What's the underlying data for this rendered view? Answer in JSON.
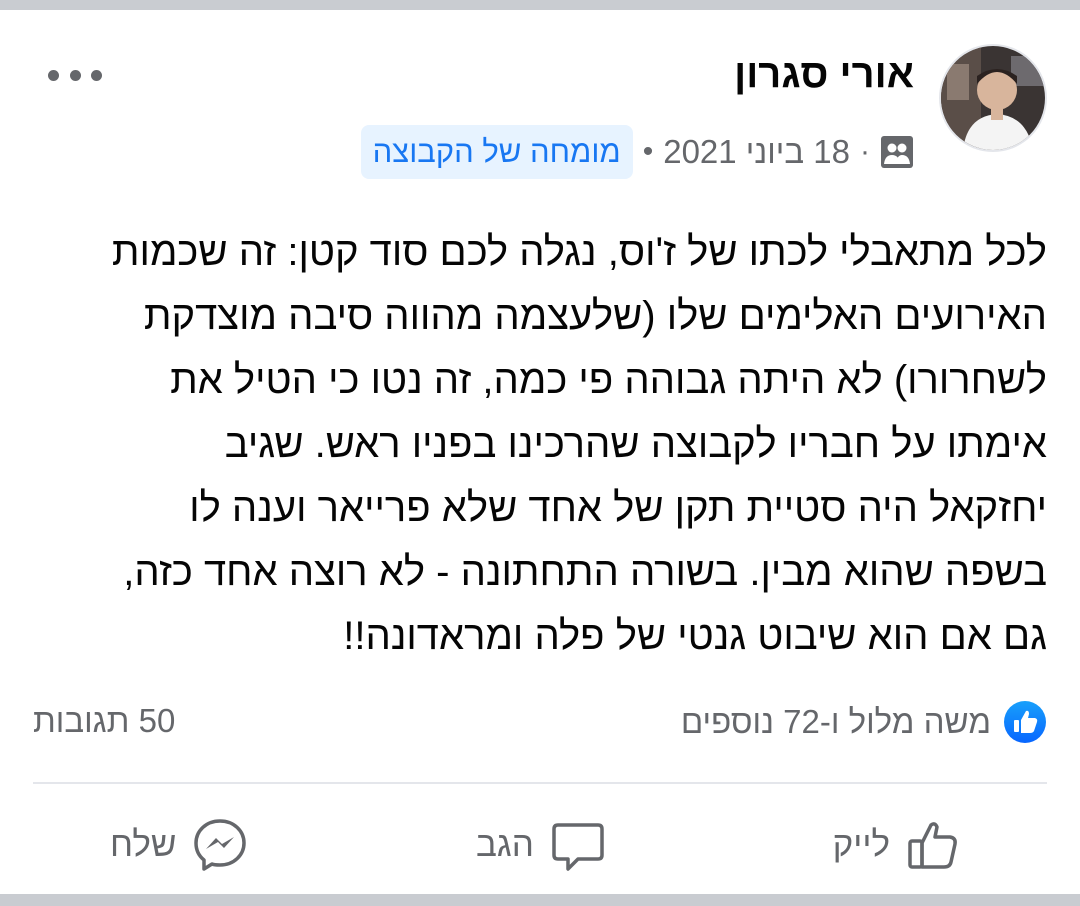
{
  "post": {
    "author_name": "אורי סגרון",
    "author_badge": "מומחה של הקבוצה",
    "meta_sep_1": "•",
    "date": "18 ביוני 2021",
    "meta_sep_2": "·",
    "audience_icon": "group-icon",
    "more_icon": "more-options-icon",
    "body_lines": [
      "לכל מתאבלי לכתו של ז'וס, נגלה לכם סוד קטן: זה שכמות",
      "האירועים האלימים שלו (שלעצמה מהווה סיבה מוצדקת",
      "לשחרורו) לא היתה גבוהה פי כמה, זה נטו כי הטיל את",
      "אימתו על חבריו לקבוצה שהרכינו בפניו ראש. שגיב",
      "יחזקאל היה סטיית תקן של אחד שלא פרייאר וענה לו",
      "בשפה שהוא מבין. בשורה התחתונה - לא רוצה אחד כזה,",
      "גם אם הוא שיבוט גנטי של פלה ומראדונה!!"
    ]
  },
  "engagement": {
    "reactions_text": "משה מלול ו-72 נוספים",
    "comments_count": "50 תגובות",
    "like_badge_icon": "like-reaction-icon"
  },
  "actions": {
    "like_label": "לייק",
    "comment_label": "הגב",
    "send_label": "שלח"
  },
  "colors": {
    "accent": "#1877f2",
    "badge_bg": "#e7f3ff",
    "secondary_text": "#65676b",
    "divider": "#e4e6eb",
    "page_bg": "#c9ccd1"
  }
}
